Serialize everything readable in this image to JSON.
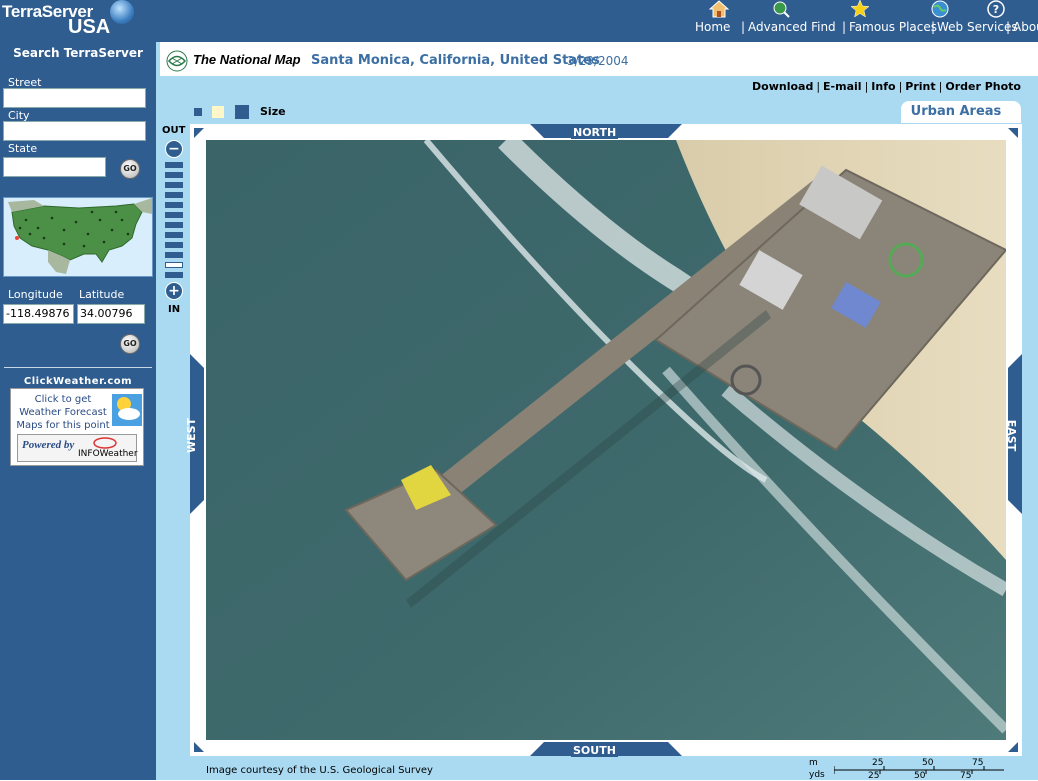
{
  "app": {
    "brand_line1": "TerraServer",
    "brand_line2": "USA"
  },
  "nav": {
    "items": [
      "Home",
      "Advanced Find",
      "Famous Places",
      "Web Services",
      "About"
    ]
  },
  "sidebar": {
    "title": "Search TerraServer",
    "street_label": "Street",
    "street_value": "",
    "city_label": "City",
    "city_value": "",
    "state_label": "State",
    "state_value": "",
    "go_label": "GO",
    "longitude_label": "Longitude",
    "longitude_value": "-118.49876",
    "latitude_label": "Latitude",
    "latitude_value": "34.00796",
    "clickweather_title": "ClickWeather.com",
    "clickweather_text": "Click to get Weather Forecast Maps for this point",
    "powered_by": "Powered by",
    "infoweather": "INFOWeather"
  },
  "header": {
    "nm_label": "The National Map",
    "place": "Santa Monica, California, United States",
    "date": "3/29/2004"
  },
  "actions": {
    "download": "Download",
    "email": "E-mail",
    "info": "Info",
    "print": "Print",
    "order": "Order Photo"
  },
  "view": {
    "size_label": "Size",
    "theme_tab": "Urban Areas",
    "zoom_out": "OUT",
    "zoom_in": "IN",
    "zoom_level_current": 9,
    "zoom_levels_total": 14
  },
  "compass": {
    "north": "NORTH",
    "south": "SOUTH",
    "west": "WEST",
    "east": "EAST"
  },
  "footer": {
    "caption": "Image courtesy of the U.S. Geological Survey",
    "scale_m": "m",
    "scale_yds": "yds",
    "m_ticks": [
      "25",
      "50",
      "75"
    ],
    "yd_ticks": [
      "25",
      "50",
      "75"
    ]
  },
  "colors": {
    "sidebar": "#2f5d8f",
    "content": "#a9daf2",
    "accent_text": "#3c6fa3",
    "size_swatches": [
      "#2f5d8f",
      "#fff7c8",
      "#2f5d8f"
    ]
  }
}
